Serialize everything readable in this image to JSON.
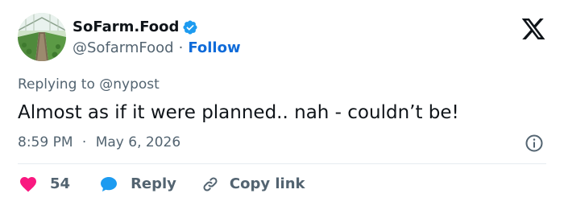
{
  "author": {
    "display_name": "SoFarm.Food",
    "handle": "@SofarmFood",
    "separator": "·",
    "follow_label": "Follow",
    "verified": true
  },
  "reply_context": {
    "prefix": "Replying to ",
    "mention": "@nypost"
  },
  "tweet": {
    "text": "Almost as if it were planned.. nah - couldn’t be!",
    "time": "8:59 PM",
    "separator": "·",
    "date": "May 6, 2026"
  },
  "actions": {
    "like_count": "54",
    "reply_label": "Reply",
    "copy_link_label": "Copy link"
  },
  "icons": {
    "logo": "x-logo-icon",
    "verified": "verified-badge-icon",
    "info": "info-icon",
    "like": "heart-icon",
    "reply": "speech-bubble-icon",
    "copy_link": "link-icon"
  },
  "colors": {
    "text_primary": "#0f1419",
    "text_secondary": "#536471",
    "link_blue": "#0f6bd9",
    "verified_blue": "#1d9bf0",
    "heart_pink": "#f91880",
    "reply_blue": "#1d9bf0",
    "divider": "#e6ecf0"
  }
}
